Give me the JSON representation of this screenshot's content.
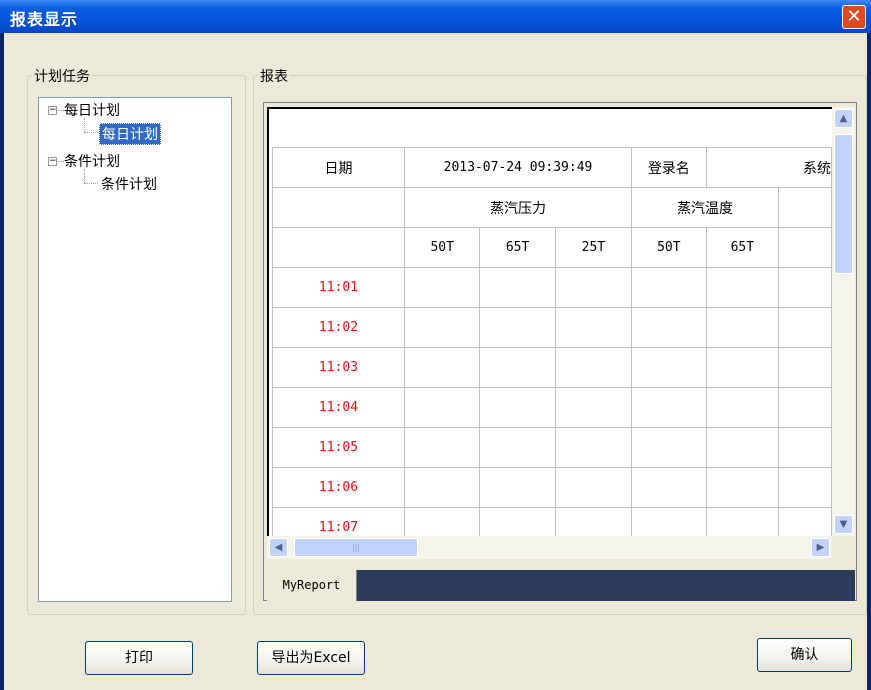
{
  "window": {
    "title": "报表显示",
    "close_glyph": "✕"
  },
  "left_panel": {
    "group_label": "计划任务",
    "tree": [
      {
        "label": "每日计划",
        "expander": "−",
        "children": [
          {
            "label": "每日计划",
            "selected": true
          }
        ]
      },
      {
        "label": "条件计划",
        "expander": "−",
        "children": [
          {
            "label": "条件计划",
            "selected": false
          }
        ]
      }
    ]
  },
  "right_panel": {
    "group_label": "报表",
    "report": {
      "header_row": {
        "date_label": "日期",
        "datetime": "2013-07-24 09:39:49",
        "login_label": "登录名",
        "partial_label": "系统"
      },
      "groups": [
        "蒸汽压力",
        "蒸汽温度"
      ],
      "subheaders": [
        "50T",
        "65T",
        "25T",
        "50T",
        "65T"
      ],
      "times": [
        "11:01",
        "11:02",
        "11:03",
        "11:04",
        "11:05",
        "11:06",
        "11:07"
      ]
    },
    "sheet_tab": "MyReport",
    "scroll_glyphs": {
      "up": "▲",
      "down": "▼",
      "left": "◀",
      "right": "▶",
      "grip": "|||"
    }
  },
  "buttons": {
    "print": "打印",
    "export": "导出为Excel",
    "confirm": "确认"
  },
  "colors": {
    "title_bar": "#0553d8",
    "time_text": "#e81010",
    "tab_bar": "#2b3d58",
    "selected": "#316ac5"
  }
}
